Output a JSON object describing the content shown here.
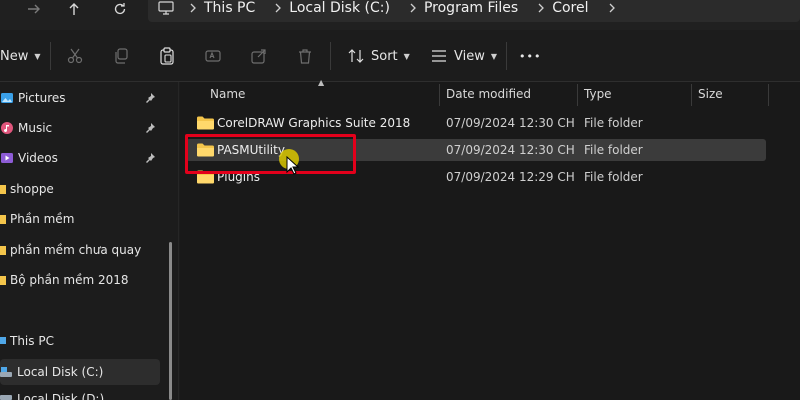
{
  "address": {
    "crumbs": [
      "This PC",
      "Local Disk (C:)",
      "Program Files",
      "Corel"
    ]
  },
  "toolbar": {
    "new_label": "New",
    "sort_label": "Sort",
    "view_label": "View",
    "more_label": "•••"
  },
  "sidebar": {
    "items": [
      {
        "label": "Pictures",
        "icon": "pictures-icon",
        "pinned": true
      },
      {
        "label": "Music",
        "icon": "music-icon",
        "pinned": true
      },
      {
        "label": "Videos",
        "icon": "videos-icon",
        "pinned": true
      },
      {
        "label": "shoppe",
        "icon": "folder-icon",
        "pinned": false
      },
      {
        "label": "Phần mềm",
        "icon": "folder-icon",
        "pinned": false
      },
      {
        "label": "phần mềm chưa quay",
        "icon": "folder-icon",
        "pinned": false
      },
      {
        "label": "Bộ phần mềm 2018",
        "icon": "folder-icon",
        "pinned": false
      },
      {
        "label": "This PC",
        "icon": "pc-icon",
        "pinned": false
      },
      {
        "label": "Local Disk (C:)",
        "icon": "drive-icon",
        "pinned": false,
        "selected": true
      },
      {
        "label": "Local Disk (D:)",
        "icon": "drive-icon",
        "pinned": false
      }
    ]
  },
  "columns": {
    "name": "Name",
    "date": "Date modified",
    "type": "Type",
    "size": "Size"
  },
  "files": [
    {
      "name": "CorelDRAW Graphics Suite 2018",
      "date": "07/09/2024 12:30 CH",
      "type": "File folder"
    },
    {
      "name": "PASMUtility",
      "date": "07/09/2024 12:30 CH",
      "type": "File folder",
      "selected": true
    },
    {
      "name": "Plugins",
      "date": "07/09/2024 12:29 CH",
      "type": "File folder"
    }
  ],
  "colors": {
    "highlight": "#e3001b",
    "folder": "#f4c54b",
    "cursor_halo": "#dac800"
  }
}
